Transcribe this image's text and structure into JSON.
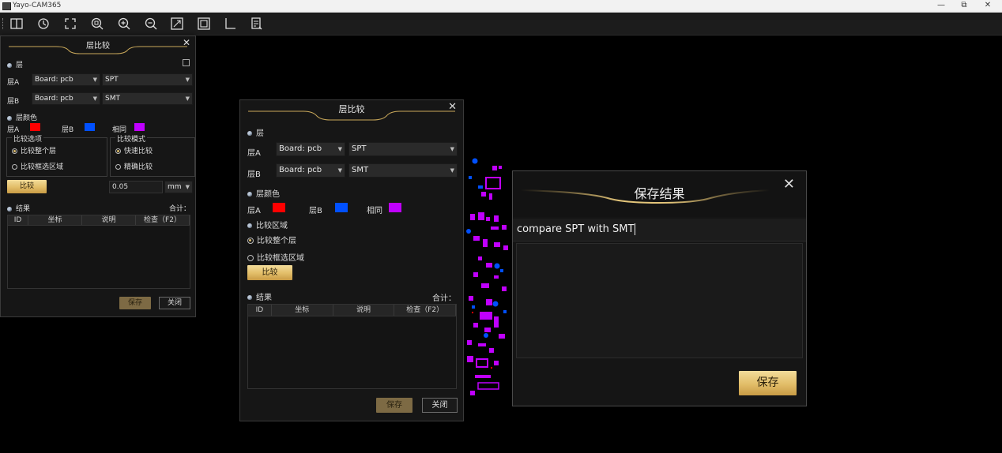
{
  "window": {
    "title": "Yayo-CAM365",
    "minimize": "—",
    "restore": "⧉",
    "close": "✕"
  },
  "toolbar": {
    "buttons": [
      "split-view-icon",
      "history-icon",
      "fit-screen-icon",
      "zoom-area-icon",
      "zoom-in-icon",
      "zoom-out-icon",
      "zoom-box-icon",
      "frame-icon",
      "corner-icon",
      "report-icon"
    ]
  },
  "panel_left": {
    "title": "层比较",
    "close": "✕",
    "section_layer": "层",
    "layer_a_label": "层A",
    "layer_b_label": "层B",
    "layer_a_board": "Board: pcb",
    "layer_a_name": "SPT",
    "layer_b_board": "Board: pcb",
    "layer_b_name": "SMT",
    "section_color": "层颜色",
    "color_a_label": "层A",
    "color_b_label": "层B",
    "color_same_label": "相同",
    "color_a": "#ff0000",
    "color_b": "#0050ff",
    "color_same": "#c000ff",
    "options_group": "比较选项",
    "opt_whole": "比较整个层",
    "opt_box": "比较框选区域",
    "mode_group": "比较模式",
    "mode_fast": "快速比较",
    "mode_precise": "精确比较",
    "compare_btn": "比较",
    "tolerance": "0.05",
    "unit": "mm",
    "section_result": "结果",
    "total_label": "合计：",
    "columns": [
      "ID",
      "坐标",
      "说明",
      "检查（F2）"
    ],
    "save_btn": "保存",
    "close_btn": "关闭"
  },
  "panel_mid": {
    "title": "层比较",
    "close": "✕",
    "section_layer": "层",
    "layer_a_label": "层A",
    "layer_b_label": "层B",
    "layer_a_board": "Board: pcb",
    "layer_a_name": "SPT",
    "layer_b_board": "Board: pcb",
    "layer_b_name": "SMT",
    "section_color": "层颜色",
    "color_a_label": "层A",
    "color_b_label": "层B",
    "color_same_label": "相同",
    "color_a": "#ff0000",
    "color_b": "#0050ff",
    "color_same": "#c000ff",
    "section_area": "比较区域",
    "opt_whole": "比较整个层",
    "opt_box": "比较框选区域",
    "compare_btn": "比较",
    "section_result": "结果",
    "total_label": "合计：",
    "columns": [
      "ID",
      "坐标",
      "说明",
      "检查（F2）"
    ],
    "save_btn": "保存",
    "close_btn": "关闭"
  },
  "save_dialog": {
    "title": "保存结果",
    "close": "✕",
    "name_value": "compare SPT with SMT",
    "save_btn": "保存"
  }
}
